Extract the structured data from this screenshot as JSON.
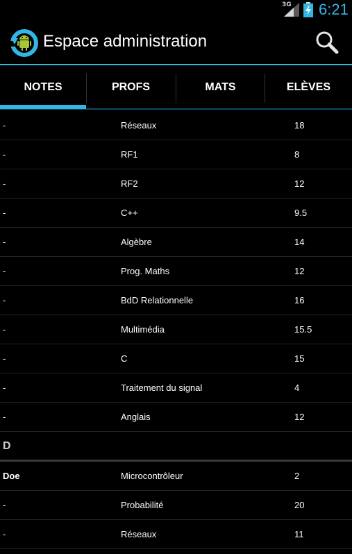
{
  "status": {
    "network": "3G",
    "time": "6:21",
    "icons": [
      "signal-icon",
      "battery-charging-icon"
    ],
    "accent": "#33b5e5"
  },
  "actionbar": {
    "title": "Espace administration",
    "app_icon": "app-logo-icon",
    "search_icon": "search-icon"
  },
  "tabs": [
    {
      "label": "NOTES",
      "active": true
    },
    {
      "label": "PROFS",
      "active": false
    },
    {
      "label": "MATS",
      "active": false
    },
    {
      "label": "ELÈVES",
      "active": false
    }
  ],
  "list": {
    "group1": [
      {
        "student": "-",
        "subject": "Réseaux",
        "grade": "18"
      },
      {
        "student": "-",
        "subject": "RF1",
        "grade": "8"
      },
      {
        "student": "-",
        "subject": "RF2",
        "grade": "12"
      },
      {
        "student": "-",
        "subject": "C++",
        "grade": "9.5"
      },
      {
        "student": "-",
        "subject": "Algèbre",
        "grade": "14"
      },
      {
        "student": "-",
        "subject": "Prog. Maths",
        "grade": "12"
      },
      {
        "student": "-",
        "subject": "BdD Relationnelle",
        "grade": "16"
      },
      {
        "student": "-",
        "subject": "Multimédia",
        "grade": "15.5"
      },
      {
        "student": "-",
        "subject": "C",
        "grade": "15"
      },
      {
        "student": "-",
        "subject": "Traitement du signal",
        "grade": "4"
      },
      {
        "student": "-",
        "subject": "Anglais",
        "grade": "12"
      }
    ],
    "section_letter": "D",
    "group2": [
      {
        "student": "Doe",
        "subject": "Microcontrôleur",
        "grade": "2"
      },
      {
        "student": "-",
        "subject": "Probabilité",
        "grade": "20"
      },
      {
        "student": "-",
        "subject": "Réseaux",
        "grade": "11"
      }
    ]
  }
}
